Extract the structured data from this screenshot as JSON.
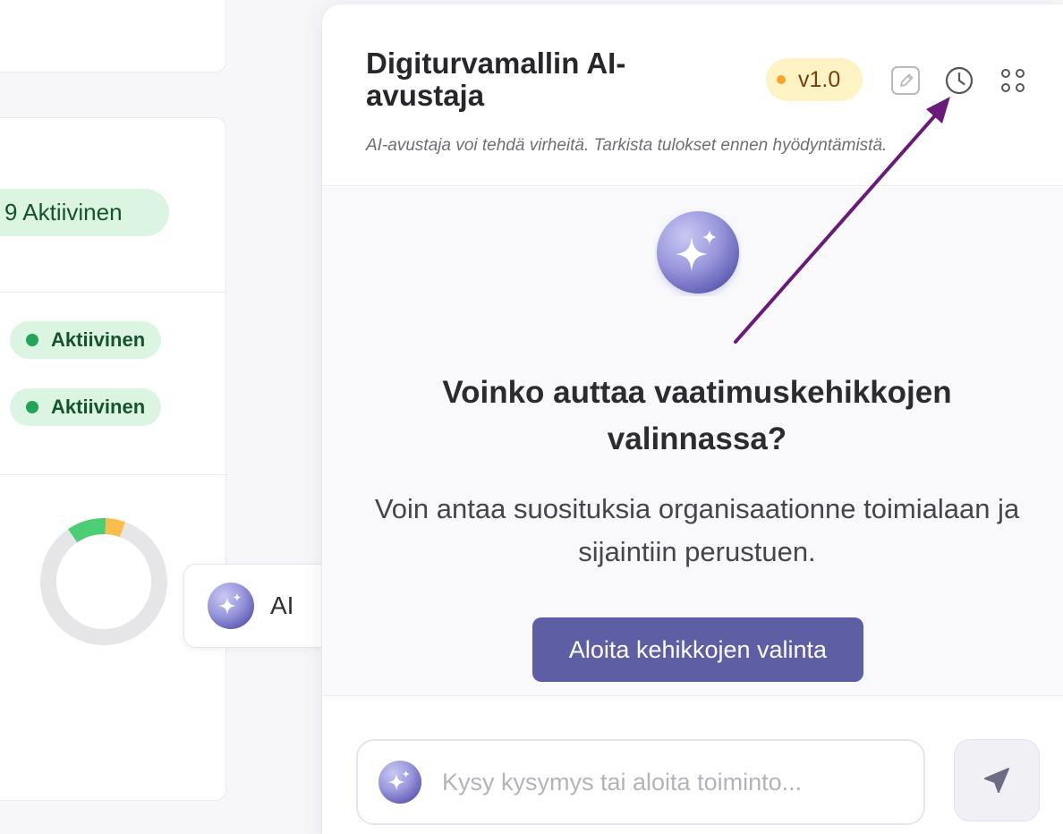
{
  "dashboard": {
    "status_summary": "9 Aktiivinen",
    "rows": [
      {
        "status": "Aktiivinen"
      },
      {
        "status": "Aktiivinen"
      }
    ],
    "donut": {
      "segments": [
        {
          "color": "#4cce75",
          "fraction": 0.1
        },
        {
          "color": "#f8bd4c",
          "fraction": 0.05
        }
      ]
    }
  },
  "ai_button": {
    "label": "AI"
  },
  "assistant": {
    "title": "Digiturvamallin AI-avustaja",
    "version": "v1.0",
    "disclaimer": "AI-avustaja voi tehdä virheitä. Tarkista tulokset ennen hyödyntämistä.",
    "question": "Voinko auttaa vaatimuskehikkojen valinnassa?",
    "description": "Voin antaa suosituksia organisaationne toimialaan ja sijaintiin perustuen.",
    "cta_label": "Aloita kehikkojen valinta",
    "input_placeholder": "Kysy kysymys tai aloita toiminto..."
  },
  "icons": {
    "edit": "pencil-icon",
    "history": "clock-icon",
    "menu": "dots-grid-icon",
    "send": "send-icon",
    "sparkle": "sparkle-icon"
  },
  "colors": {
    "accent": "#5d5ea3",
    "active_green": "#22a45a",
    "badge_green_bg": "#dcf4e2",
    "version_bg": "#fdf3c4",
    "annotation_arrow": "#6a1b7a"
  }
}
